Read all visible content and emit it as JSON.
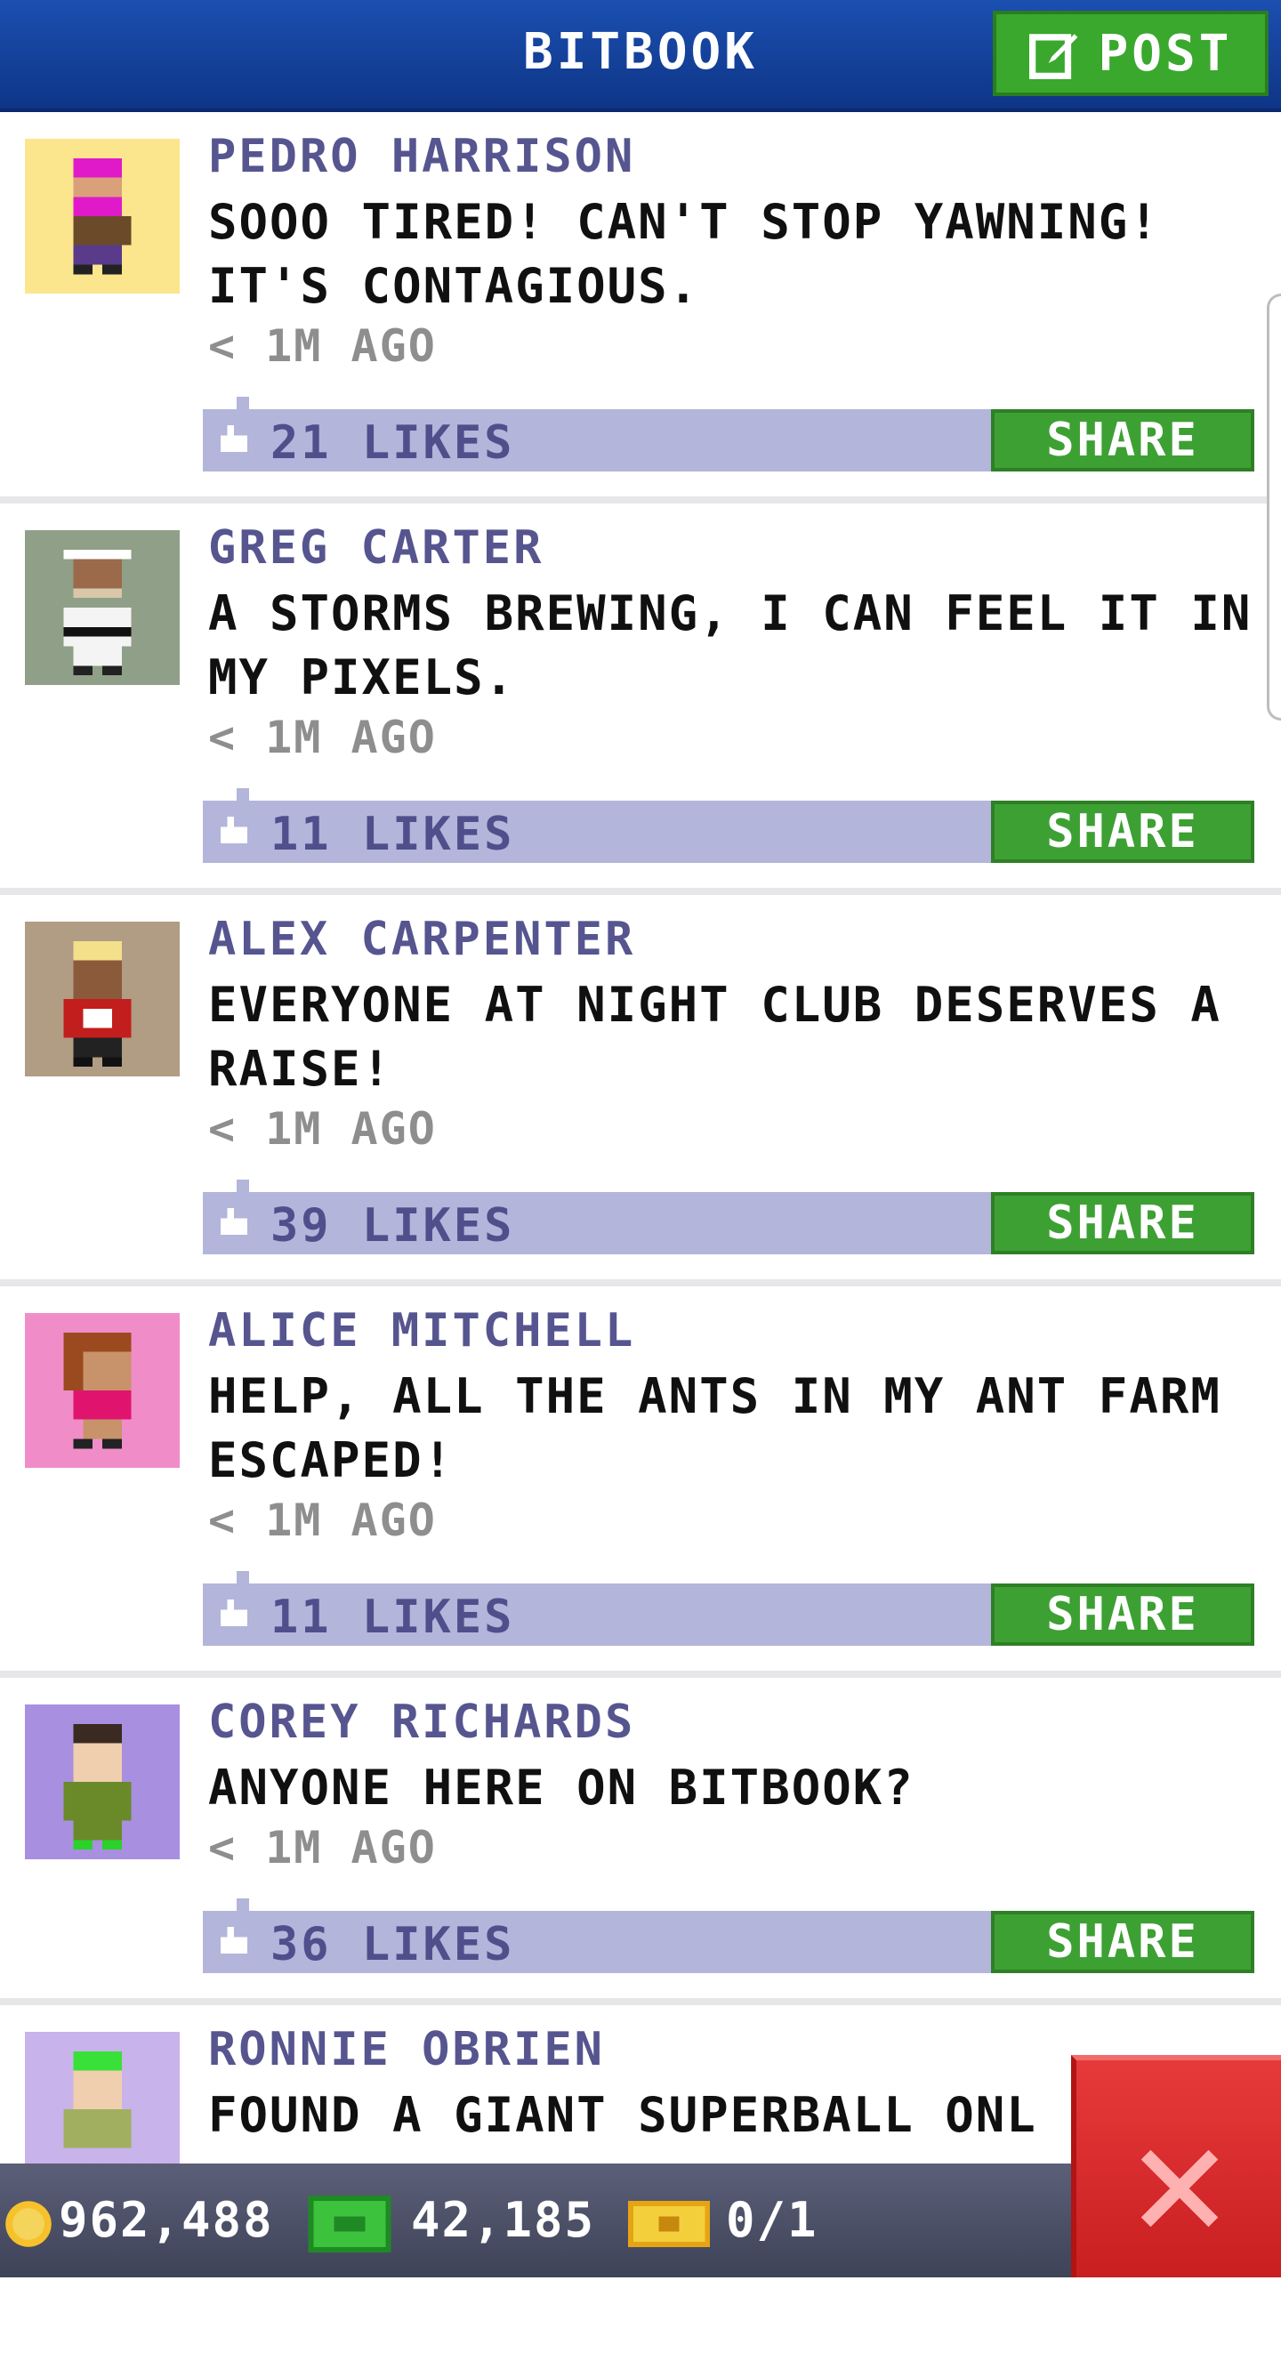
{
  "header": {
    "title": "BITBOOK",
    "post_label": "POST"
  },
  "posts": [
    {
      "name": "PEDRO HARRISON",
      "text": "SOOO TIRED! CAN'T STOP YAWNING! IT'S CONTAGIOUS.",
      "time": "< 1M AGO",
      "likes": "21 LIKES",
      "share": "SHARE",
      "avatar_bg": "#fbe68e"
    },
    {
      "name": "GREG CARTER",
      "text": "A STORMS BREWING, I CAN FEEL IT IN MY PIXELS.",
      "time": "< 1M AGO",
      "likes": "11 LIKES",
      "share": "SHARE",
      "avatar_bg": "#909f88"
    },
    {
      "name": "ALEX CARPENTER",
      "text": "EVERYONE AT NIGHT CLUB DESERVES A RAISE!",
      "time": "< 1M AGO",
      "likes": "39 LIKES",
      "share": "SHARE",
      "avatar_bg": "#b19c84"
    },
    {
      "name": "ALICE MITCHELL",
      "text": "HELP, ALL THE ANTS IN MY ANT FARM ESCAPED!",
      "time": "< 1M AGO",
      "likes": "11 LIKES",
      "share": "SHARE",
      "avatar_bg": "#f08dc8"
    },
    {
      "name": "COREY RICHARDS",
      "text": "ANYONE HERE ON BITBOOK?",
      "time": "< 1M AGO",
      "likes": "36 LIKES",
      "share": "SHARE",
      "avatar_bg": "#a88fe0"
    },
    {
      "name": "RONNIE OBRIEN",
      "text": "FOUND A GIANT SUPERBALL ONL",
      "avatar_bg": "#c8b3ea"
    }
  ],
  "footer": {
    "coins": "962,488",
    "bux": "42,185",
    "tickets": "0/1"
  },
  "colors": {
    "header": "#1b4fb0",
    "accent_green": "#3da033",
    "like_bar": "#b3b5da",
    "name": "#56558f",
    "close": "#d8292b"
  }
}
